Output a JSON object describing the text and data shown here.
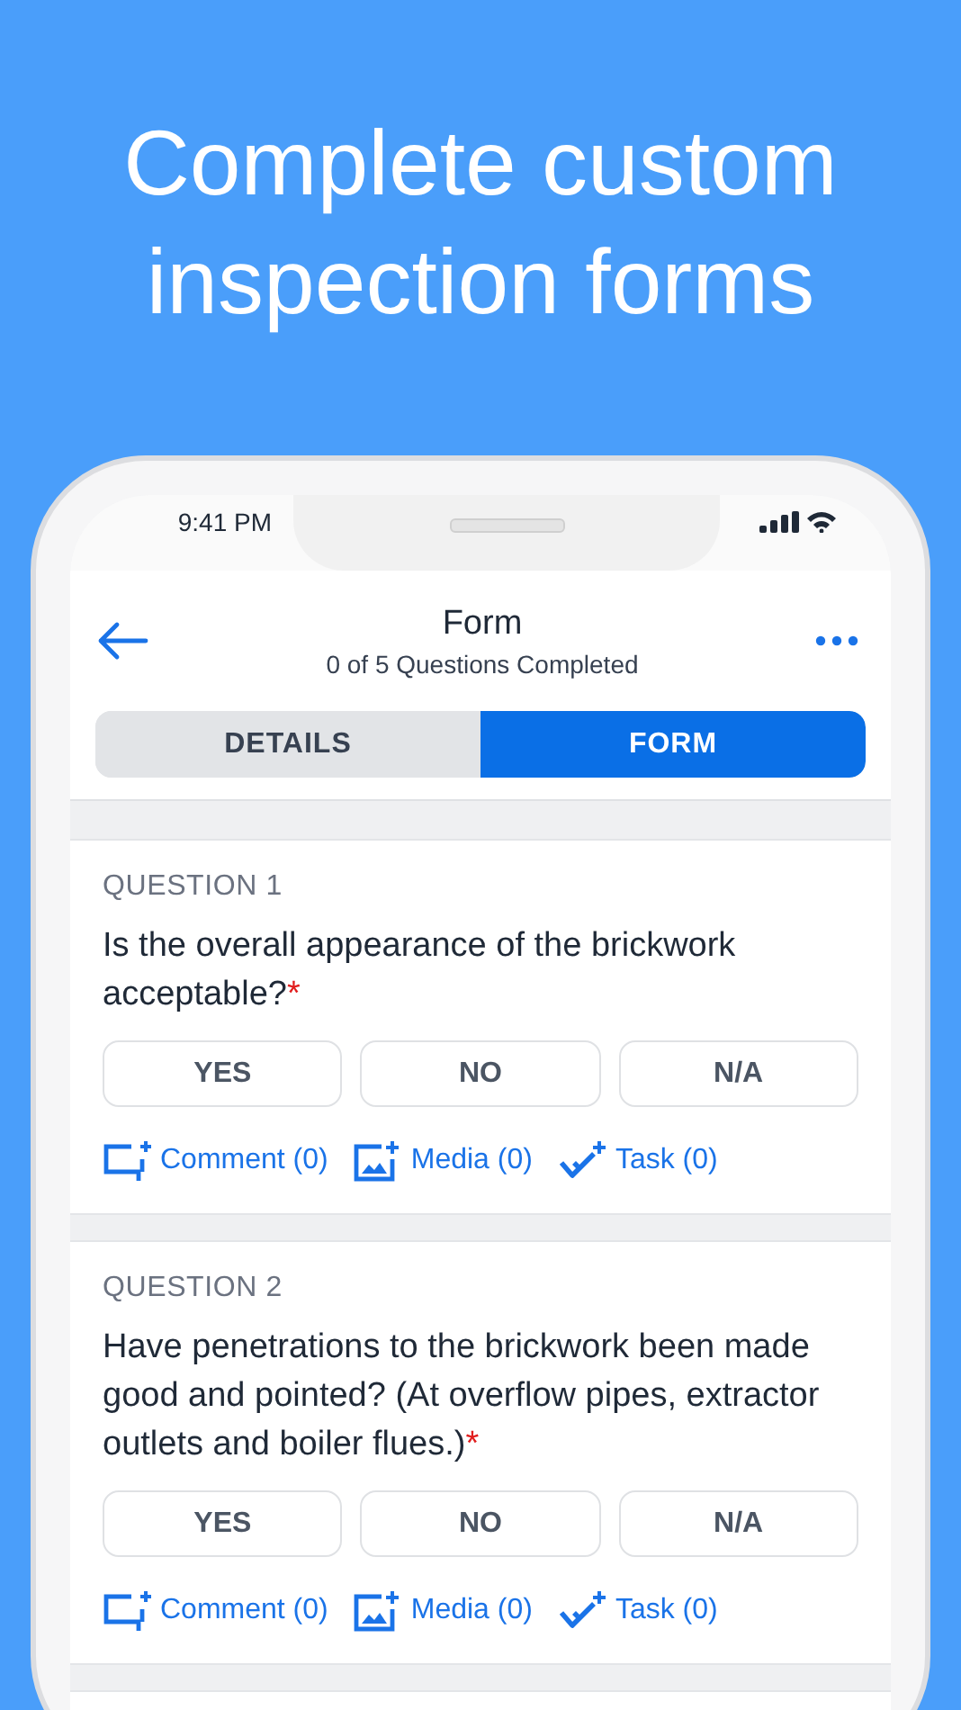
{
  "headline": "Complete custom inspection forms",
  "status_bar": {
    "time": "9:41 PM"
  },
  "header": {
    "title": "Form",
    "subtitle": "0 of 5 Questions Completed"
  },
  "tabs": [
    {
      "label": "DETAILS",
      "selected": false
    },
    {
      "label": "FORM",
      "selected": true
    }
  ],
  "questions": [
    {
      "number": "QUESTION 1",
      "text": "Is the overall appearance of the brickwork acceptable?",
      "required_mark": "*",
      "answers": [
        {
          "label": "YES",
          "selected": false
        },
        {
          "label": "NO",
          "selected": false
        },
        {
          "label": "N/A",
          "selected": false
        }
      ],
      "actions": [
        {
          "kind": "comment",
          "label": "Comment (0)"
        },
        {
          "kind": "media",
          "label": "Media (0)"
        },
        {
          "kind": "task",
          "label": "Task (0)"
        }
      ]
    },
    {
      "number": "QUESTION 2",
      "text": "Have penetrations to the brickwork been made good and pointed? (At overflow pipes, extractor outlets and boiler flues.)",
      "required_mark": "*",
      "answers": [
        {
          "label": "YES",
          "selected": false
        },
        {
          "label": "NO",
          "selected": false
        },
        {
          "label": "N/A",
          "selected": false
        }
      ],
      "actions": [
        {
          "kind": "comment",
          "label": "Comment (0)"
        },
        {
          "kind": "media",
          "label": "Media (0)"
        },
        {
          "kind": "task",
          "label": "Task (0)"
        }
      ]
    }
  ]
}
